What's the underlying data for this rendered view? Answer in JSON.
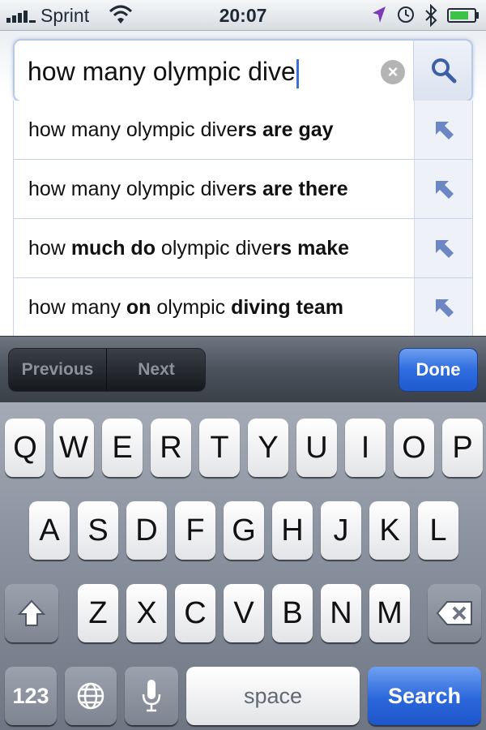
{
  "status_bar": {
    "carrier": "Sprint",
    "time": "20:07",
    "icons": [
      "signal-icon",
      "wifi-icon",
      "location-icon",
      "clock-icon",
      "bluetooth-icon",
      "battery-icon"
    ]
  },
  "search": {
    "query": "how many olympic dive",
    "clear_icon": "×"
  },
  "suggestions": [
    {
      "segments": [
        {
          "t": "how many olympic dive",
          "b": false
        },
        {
          "t": "rs are gay",
          "b": true
        }
      ]
    },
    {
      "segments": [
        {
          "t": "how many olympic dive",
          "b": false
        },
        {
          "t": "rs are there",
          "b": true
        }
      ]
    },
    {
      "segments": [
        {
          "t": "how ",
          "b": false
        },
        {
          "t": "much do",
          "b": true
        },
        {
          "t": " olympic dive",
          "b": false
        },
        {
          "t": "rs make",
          "b": true
        }
      ]
    },
    {
      "segments": [
        {
          "t": "how many ",
          "b": false
        },
        {
          "t": "on",
          "b": true
        },
        {
          "t": " olympic ",
          "b": false
        },
        {
          "t": "diving team",
          "b": true
        }
      ]
    }
  ],
  "toolbar": {
    "previous": "Previous",
    "next": "Next",
    "done": "Done"
  },
  "keyboard": {
    "row1": [
      "Q",
      "W",
      "E",
      "R",
      "T",
      "Y",
      "U",
      "I",
      "O",
      "P"
    ],
    "row2": [
      "A",
      "S",
      "D",
      "F",
      "G",
      "H",
      "J",
      "K",
      "L"
    ],
    "row3": [
      "Z",
      "X",
      "C",
      "V",
      "B",
      "N",
      "M"
    ],
    "numbers": "123",
    "space": "space",
    "search": "Search"
  },
  "colors": {
    "accent_blue": "#2b67dc",
    "keyboard_bg": "#8d94a1"
  }
}
